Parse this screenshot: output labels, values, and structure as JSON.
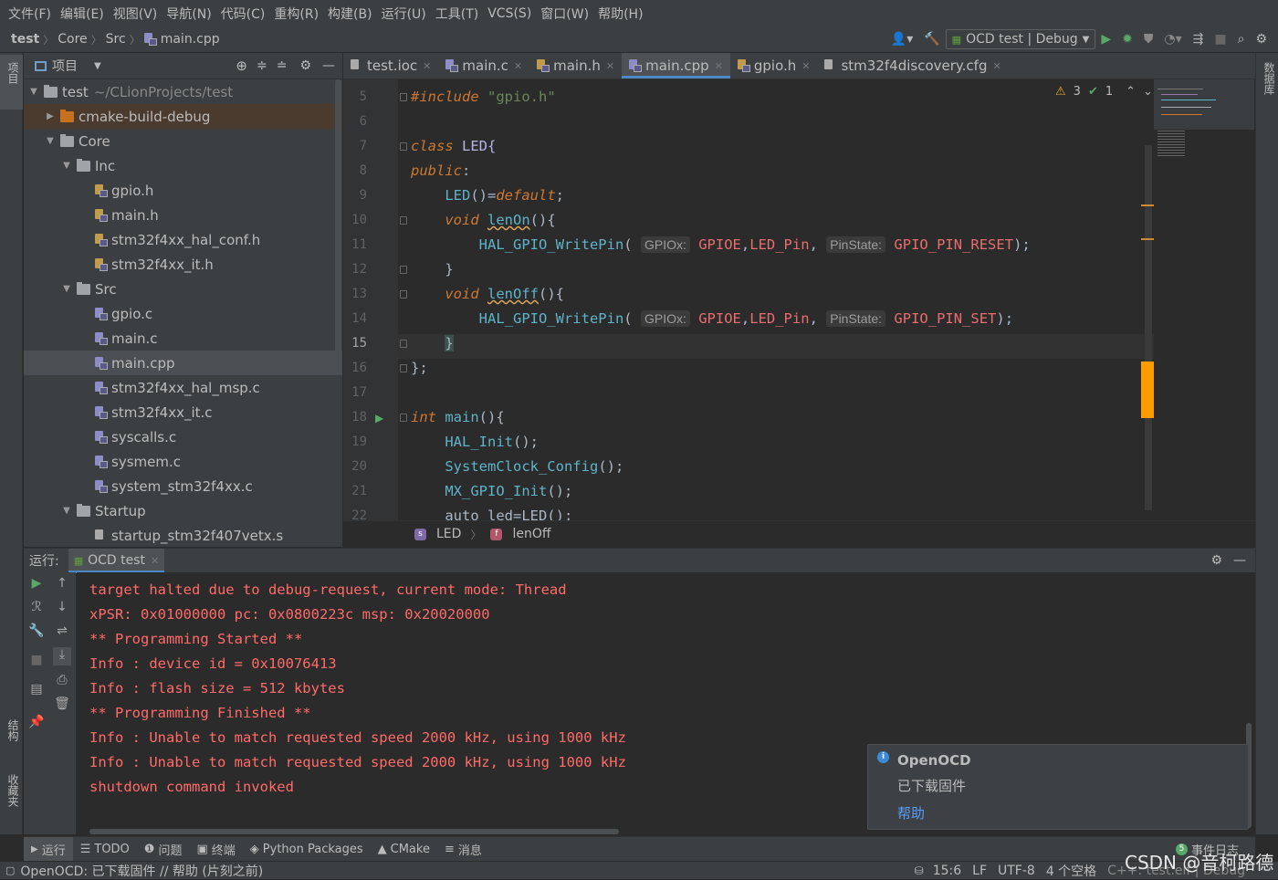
{
  "menu": [
    "文件(F)",
    "编辑(E)",
    "视图(V)",
    "导航(N)",
    "代码(C)",
    "重构(R)",
    "构建(B)",
    "运行(U)",
    "工具(T)",
    "VCS(S)",
    "窗口(W)",
    "帮助(H)"
  ],
  "breadcrumb": {
    "project": "test",
    "dir1": "Core",
    "dir2": "Src",
    "file": "main.cpp"
  },
  "run_config": "OCD test | Debug",
  "project_panel": {
    "title": "项目"
  },
  "left_strip": {
    "project": "项目",
    "structure": "结构",
    "favorites": "收藏夹"
  },
  "right_strip": {
    "database": "数据库"
  },
  "tree": {
    "root": "test",
    "root_path": "~/CLionProjects/test",
    "cmake": "cmake-build-debug",
    "core": "Core",
    "inc": "Inc",
    "inc_files": [
      "gpio.h",
      "main.h",
      "stm32f4xx_hal_conf.h",
      "stm32f4xx_it.h"
    ],
    "src": "Src",
    "src_files": [
      "gpio.c",
      "main.c",
      "main.cpp",
      "stm32f4xx_hal_msp.c",
      "stm32f4xx_it.c",
      "syscalls.c",
      "sysmem.c",
      "system_stm32f4xx.c"
    ],
    "startup": "Startup",
    "startup_files": [
      "startup_stm32f407vetx.s"
    ]
  },
  "tabs": [
    "test.ioc",
    "main.c",
    "main.h",
    "main.cpp",
    "gpio.h",
    "stm32f4discovery.cfg"
  ],
  "inspections": {
    "warnings": "3",
    "ok": "1"
  },
  "code": {
    "l5_kw": "#include",
    "l5_str": "\"gpio.h\"",
    "l7_kw": "class",
    "l7_name": "LED{",
    "l8_kw": "public",
    "l9_a": "LED",
    "l9_b": "()=",
    "l9_c": "default",
    "l10_kw": "void",
    "l10_fn": "lenOn",
    "l10_rest": "(){",
    "l11_fn": "HAL_GPIO_WritePin",
    "hint1": "GPIOx:",
    "arg1": "GPIOE",
    "arg2": "LED_Pin",
    "hint2": "PinState:",
    "arg3": "GPIO_PIN_RESET",
    "l11_end": ");",
    "l12": "}",
    "l13_kw": "void",
    "l13_fn": "lenOff",
    "l13_rest": "(){",
    "l14_arg3": "GPIO_PIN_SET",
    "l15": "}",
    "l16": "};",
    "l18_kw": "int",
    "l18_fn": "main",
    "l18_rest": "(){",
    "l19": "HAL_Init",
    "l20": "SystemClock_Config",
    "l21": "MX_GPIO_Init",
    "call_end": "();",
    "l22": "auto led=LED();"
  },
  "line_numbers": [
    "5",
    "6",
    "7",
    "8",
    "9",
    "10",
    "11",
    "12",
    "13",
    "14",
    "15",
    "16",
    "17",
    "18",
    "19",
    "20",
    "21",
    "22"
  ],
  "editor_crumbs": {
    "cls": "LED",
    "fn": "lenOff"
  },
  "run_panel": {
    "label": "运行:",
    "tab": "OCD test"
  },
  "console": [
    "target halted due to debug-request, current mode: Thread",
    "xPSR: 0x01000000 pc: 0x0800223c msp: 0x20020000",
    "** Programming Started **",
    "Info : device id = 0x10076413",
    "Info : flash size = 512 kbytes",
    "** Programming Finished **",
    "Info : Unable to match requested speed 2000 kHz, using 1000 kHz",
    "Info : Unable to match requested speed 2000 kHz, using 1000 kHz",
    "shutdown command invoked"
  ],
  "notification": {
    "title": "OpenOCD",
    "body": "已下载固件",
    "link": "帮助"
  },
  "bottom_tabs": [
    "运行",
    "TODO",
    "问题",
    "终端",
    "Python Packages",
    "CMake",
    "消息"
  ],
  "event_log": {
    "count": "5",
    "label": "事件日志"
  },
  "status": {
    "message": "OpenOCD: 已下载固件 // 帮助 (片刻之前)",
    "position": "15:6",
    "line_sep": "LF",
    "encoding": "UTF-8",
    "indent": "4 个空格",
    "context": "C++: test.elf | Debug"
  },
  "watermark": "CSDN @音柯路德",
  "colors": {
    "accent": "#4a88c7",
    "console_text": "#ff6b68",
    "warning": "#f0a732"
  }
}
